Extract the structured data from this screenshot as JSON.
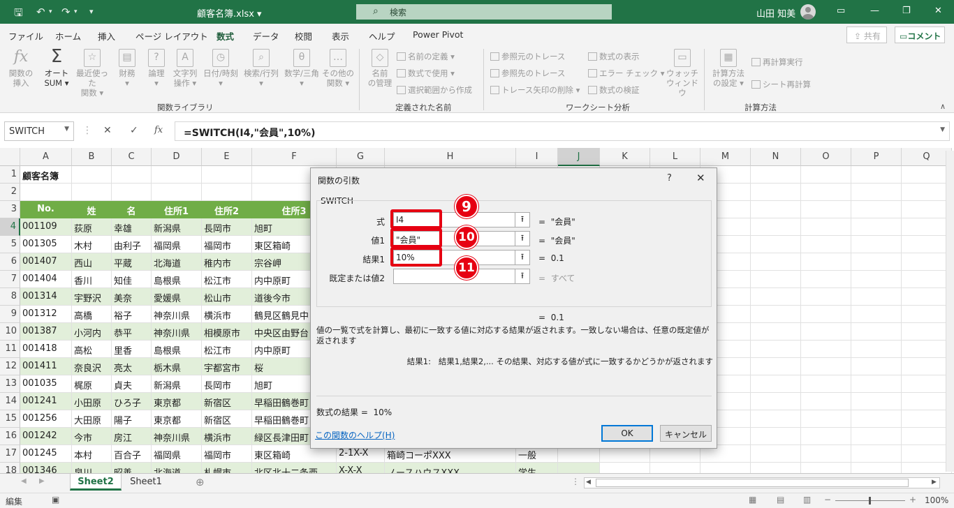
{
  "titlebar": {
    "filename": "顧客名簿.xlsx",
    "search_placeholder": "検索",
    "user": "山田 知美"
  },
  "ribbon_tabs": [
    "ファイル",
    "ホーム",
    "挿入",
    "ページ レイアウト",
    "数式",
    "データ",
    "校閲",
    "表示",
    "ヘルプ",
    "Power Pivot"
  ],
  "share_label": "共有",
  "comment_label": "コメント",
  "ribbon": {
    "fn_library": {
      "group_label": "関数ライブラリ",
      "insert_fn": [
        "関数の",
        "挿入"
      ],
      "autosum": [
        "オート",
        "SUM"
      ],
      "recent": [
        "最近使った",
        "関数"
      ],
      "financial": "財務",
      "logical": "論理",
      "text": [
        "文字列",
        "操作"
      ],
      "datetime": "日付/時刻",
      "lookup": "検索/行列",
      "math": "数学/三角",
      "more": [
        "その他の",
        "関数"
      ]
    },
    "defined_names": {
      "group_label": "定義された名前",
      "name_manager": [
        "名前",
        "の管理"
      ],
      "define_name": "名前の定義",
      "use_in_formula": "数式で使用",
      "create_from_selection": "選択範囲から作成"
    },
    "auditing": {
      "group_label": "ワークシート分析",
      "trace_precedents": "参照元のトレース",
      "trace_dependents": "参照先のトレース",
      "remove_arrows": "トレース矢印の削除",
      "show_formulas": "数式の表示",
      "error_check": "エラー チェック",
      "evaluate": "数式の検証",
      "watch_window": [
        "ウォッチ",
        "ウィンドウ"
      ]
    },
    "calculation": {
      "group_label": "計算方法",
      "calc_options": [
        "計算方法",
        "の設定"
      ],
      "calc_now": "再計算実行",
      "calc_sheet": "シート再計算"
    }
  },
  "formula_bar": {
    "name_box": "SWITCH",
    "formula": "=SWITCH(I4,\"会員\",10%)"
  },
  "columns": [
    "A",
    "B",
    "C",
    "D",
    "E",
    "F",
    "G",
    "H",
    "I",
    "J",
    "K",
    "L",
    "M",
    "N",
    "O",
    "P",
    "Q"
  ],
  "rows": [
    {
      "n": "1",
      "cells": [
        "顧客名簿",
        "",
        "",
        "",
        "",
        "",
        "",
        "",
        "",
        ""
      ]
    },
    {
      "n": "2",
      "cells": [
        "",
        "",
        "",
        "",
        "",
        "",
        "",
        "",
        "",
        ""
      ]
    },
    {
      "n": "3",
      "cells": [
        "No.",
        "姓",
        "名",
        "住所1",
        "住所2",
        "住所3",
        "",
        "",
        "",
        ""
      ]
    },
    {
      "n": "4",
      "cells": [
        "001109",
        "荻原",
        "幸雄",
        "新潟県",
        "長岡市",
        "旭町",
        "",
        "",
        "",
        ""
      ]
    },
    {
      "n": "5",
      "cells": [
        "001305",
        "木村",
        "由利子",
        "福岡県",
        "福岡市",
        "東区箱崎",
        "",
        "",
        "",
        ""
      ]
    },
    {
      "n": "6",
      "cells": [
        "001407",
        "西山",
        "平蔵",
        "北海道",
        "稚内市",
        "宗谷岬",
        "",
        "",
        "",
        ""
      ]
    },
    {
      "n": "7",
      "cells": [
        "001404",
        "香川",
        "知佳",
        "島根県",
        "松江市",
        "内中原町",
        "",
        "",
        "",
        ""
      ]
    },
    {
      "n": "8",
      "cells": [
        "001314",
        "宇野沢",
        "美奈",
        "愛媛県",
        "松山市",
        "道後今市",
        "",
        "",
        "",
        ""
      ]
    },
    {
      "n": "9",
      "cells": [
        "001312",
        "高橋",
        "裕子",
        "神奈川県",
        "横浜市",
        "鶴見区鶴見中",
        "",
        "",
        "",
        ""
      ]
    },
    {
      "n": "10",
      "cells": [
        "001387",
        "小河内",
        "恭平",
        "神奈川県",
        "相模原市",
        "中央区由野台",
        "",
        "",
        "",
        ""
      ]
    },
    {
      "n": "11",
      "cells": [
        "001418",
        "高松",
        "里香",
        "島根県",
        "松江市",
        "内中原町",
        "",
        "",
        "",
        ""
      ]
    },
    {
      "n": "12",
      "cells": [
        "001411",
        "奈良沢",
        "亮太",
        "栃木県",
        "宇都宮市",
        "桜",
        "",
        "",
        "",
        ""
      ]
    },
    {
      "n": "13",
      "cells": [
        "001035",
        "梶原",
        "貞夫",
        "新潟県",
        "長岡市",
        "旭町",
        "",
        "",
        "",
        ""
      ]
    },
    {
      "n": "14",
      "cells": [
        "001241",
        "小田原",
        "ひろ子",
        "東京都",
        "新宿区",
        "早稲田鶴巻町",
        "",
        "",
        "",
        ""
      ]
    },
    {
      "n": "15",
      "cells": [
        "001256",
        "大田原",
        "陽子",
        "東京都",
        "新宿区",
        "早稲田鶴巻町",
        "",
        "",
        "",
        ""
      ]
    },
    {
      "n": "16",
      "cells": [
        "001242",
        "今市",
        "房江",
        "神奈川県",
        "横浜市",
        "緑区長津田町",
        "",
        "",
        "",
        ""
      ]
    },
    {
      "n": "17",
      "cells": [
        "001245",
        "本村",
        "百合子",
        "福岡県",
        "福岡市",
        "東区箱崎",
        "2-1X-X",
        "箱崎コーポXXX",
        "一般",
        ""
      ]
    },
    {
      "n": "18",
      "cells": [
        "001346",
        "泉川",
        "昭善",
        "北海道",
        "札幌市",
        "北区北十二条西",
        "X-X-X",
        "ノースハウスXXX",
        "学生",
        ""
      ]
    }
  ],
  "sheets": {
    "active": "Sheet2",
    "other": "Sheet1",
    "add": "⊕"
  },
  "status": {
    "mode": "編集",
    "zoom": "100%"
  },
  "dialog": {
    "title": "関数の引数",
    "help_q": "?",
    "close": "✕",
    "function_name": "SWITCH",
    "args": [
      {
        "label": "式",
        "value": "I4",
        "result": "\"会員\""
      },
      {
        "label": "値1",
        "value": "\"会員\"",
        "result": "\"会員\""
      },
      {
        "label": "結果1",
        "value": "10%",
        "result": "0.1"
      },
      {
        "label": "既定または値2",
        "value": "",
        "result": "すべて"
      }
    ],
    "eq": "=",
    "overall_result": "0.1",
    "description": "値の一覧で式を計算し、最初に一致する値に対応する結果が返されます。一致しない場合は、任意の既定値が返されます",
    "arg_help_label": "結果1:",
    "arg_help_text": "結果1,結果2,... その結果、対応する値が式に一致するかどうかが返されます",
    "formula_result_label": "数式の結果 =",
    "formula_result_value": "10%",
    "help_link": "この関数のヘルプ(H)",
    "ok": "OK",
    "cancel": "キャンセル",
    "badges": [
      "9",
      "10",
      "11"
    ]
  }
}
